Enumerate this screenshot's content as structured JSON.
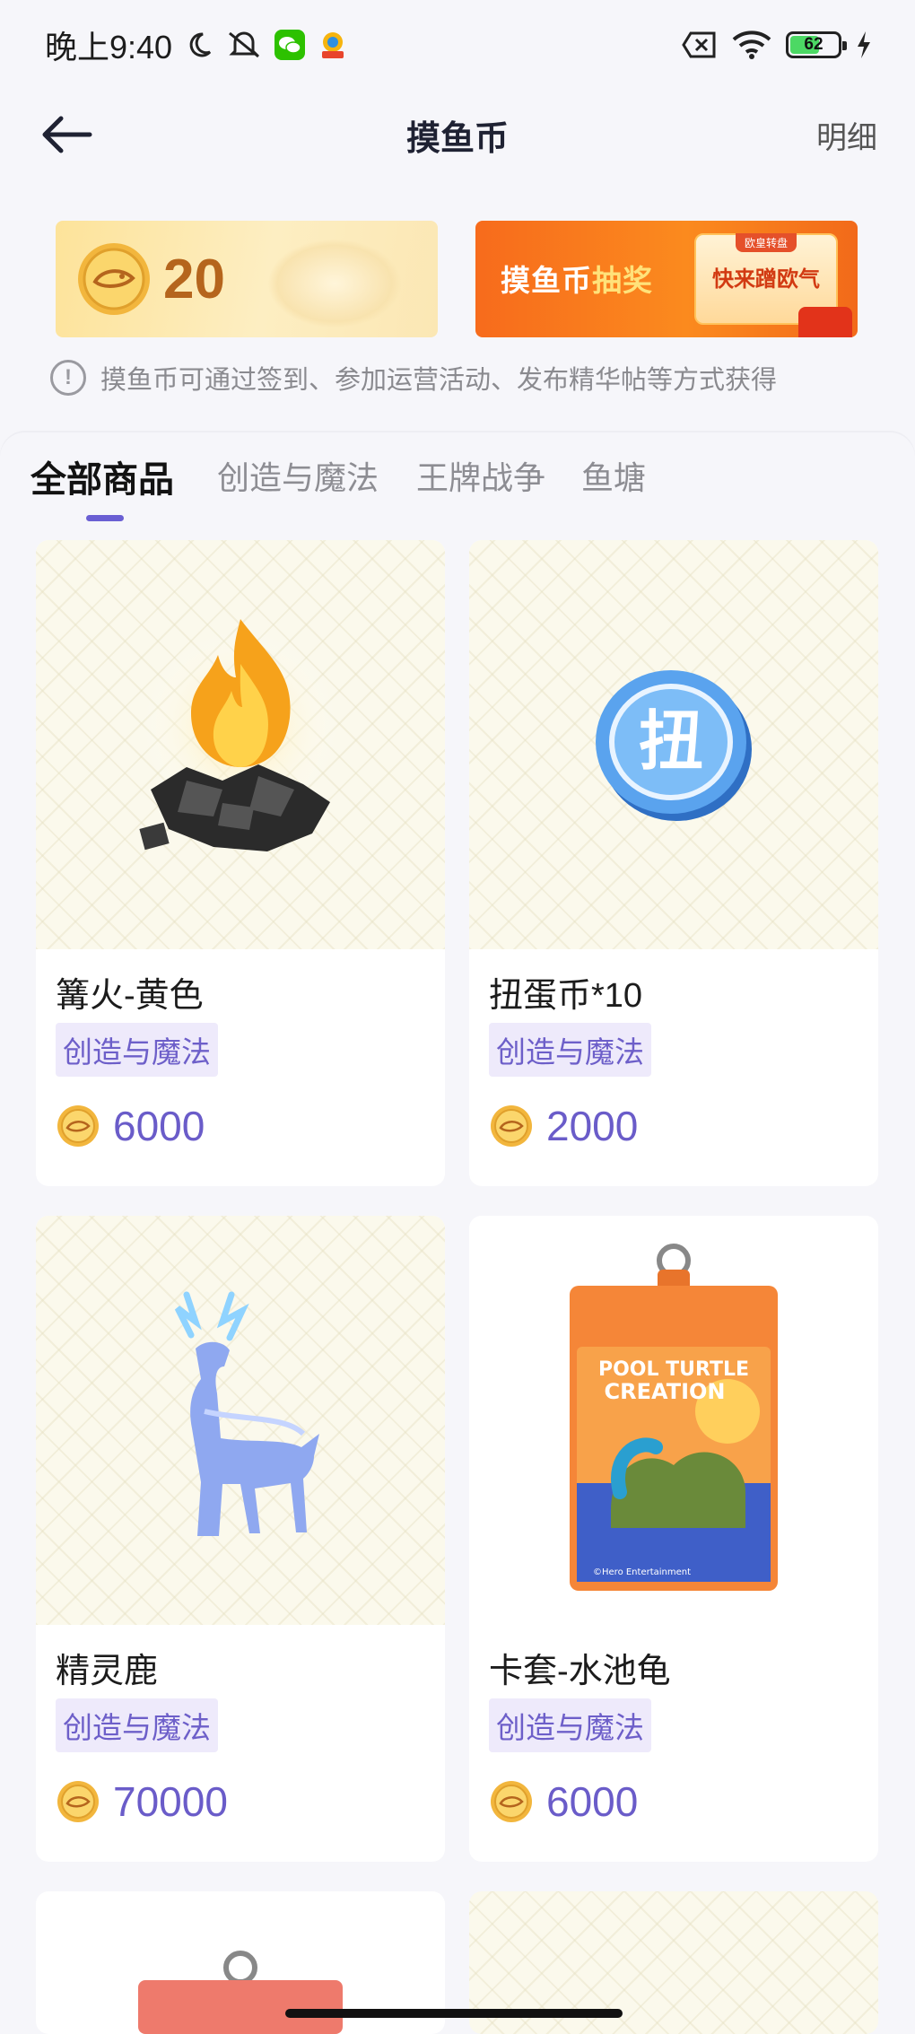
{
  "status_bar": {
    "time": "晚上9:40",
    "battery": "62",
    "icons": [
      "moon-icon",
      "mute-icon",
      "wechat-icon",
      "app-icon",
      "sim-off-icon",
      "wifi-icon",
      "battery-icon",
      "charging-icon"
    ]
  },
  "header": {
    "title": "摸鱼币",
    "detail": "明细"
  },
  "banners": {
    "coin_balance": "20",
    "lottery_title_a": "摸鱼币",
    "lottery_title_b": "抽奖",
    "lottery_cta": "快来蹭欧气",
    "lottery_tag": "欧皇转盘"
  },
  "hint": "摸鱼币可通过签到、参加运营活动、发布精华帖等方式获得",
  "tabs": [
    "全部商品",
    "创造与魔法",
    "王牌战争",
    "鱼塘"
  ],
  "active_tab": 0,
  "products": [
    {
      "name": "篝火-黄色",
      "tag": "创造与魔法",
      "price": "6000",
      "image": "campfire"
    },
    {
      "name": "扭蛋币*10",
      "tag": "创造与魔法",
      "price": "2000",
      "image": "gacha-coin"
    },
    {
      "name": "精灵鹿",
      "tag": "创造与魔法",
      "price": "70000",
      "image": "spirit-deer"
    },
    {
      "name": "卡套-水池龟",
      "tag": "创造与魔法",
      "price": "6000",
      "image": "card-holder"
    }
  ],
  "card_holder_text": {
    "line1": "POOL TURTLE",
    "line2": "CREATION",
    "footer": "©Hero Entertainment"
  },
  "gacha_coin_char": "扭",
  "colors": {
    "accent": "#6a5fd3",
    "price": "#6a5cc9",
    "tag_bg": "#eeeafb",
    "lottery": "#f76b1c"
  }
}
